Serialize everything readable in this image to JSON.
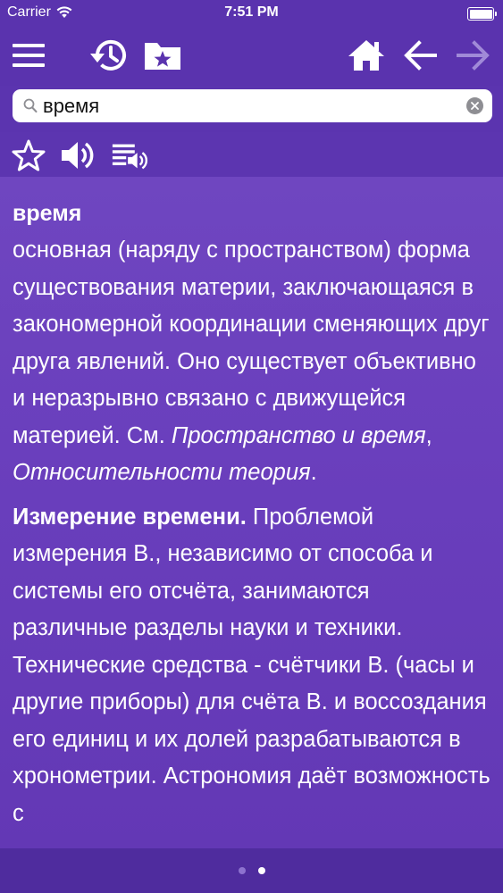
{
  "status_bar": {
    "carrier": "Carrier",
    "time": "7:51 PM"
  },
  "toolbar": {
    "icons": [
      "menu-icon",
      "history-icon",
      "bookmarks-folder-icon",
      "home-icon",
      "back-arrow-icon",
      "forward-arrow-icon"
    ]
  },
  "search": {
    "value": "время",
    "placeholder": ""
  },
  "actions": {
    "icons": [
      "star-icon",
      "speaker-icon",
      "playlist-audio-icon"
    ]
  },
  "article": {
    "headword": "время",
    "definition_text": "основная (наряду с пространством) форма существования материи, заключающаяся в закономерной координации сменяющих друг друга явлений. Оно существует объективно и неразрывно связано с движущейся материей. См. ",
    "link_1": "Пространство и время",
    "separator": ", ",
    "link_2": "Относительности теория",
    "period": ".",
    "section_title": "Измерение времени.",
    "section_text": " Проблемой измерения В., независимо от способа и системы его отсчёта, занимаются различные разделы науки и техники. Технические средства - счётчики В. (часы и другие приборы) для счёта В. и воссоздания его единиц и их долей разрабатываются в хронометрии. Астрономия даёт возможность с"
  },
  "pager": {
    "pages": 2,
    "current": 2
  },
  "colors": {
    "toolbar_bg": "#5a33ae",
    "content_bg": "#6a3fbd",
    "bottom_bg": "#4f2c9e",
    "forward_disabled": "#a08ad8"
  }
}
